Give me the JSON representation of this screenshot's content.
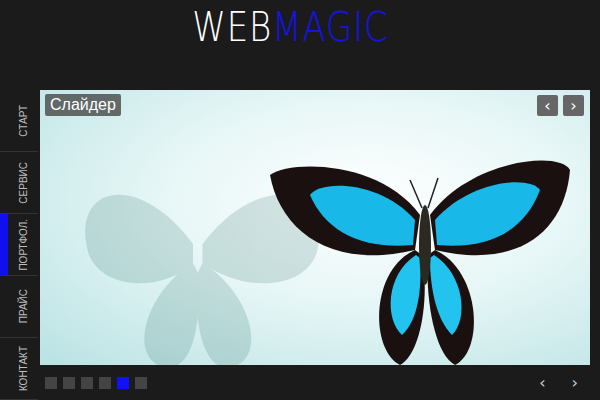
{
  "logo": {
    "part1": "WEB",
    "part2": "MAGIC"
  },
  "nav": [
    {
      "label": "СТАРТ",
      "selected": false
    },
    {
      "label": "СЕРВИС",
      "selected": false
    },
    {
      "label": "ПОРТФОЛ.",
      "selected": true
    },
    {
      "label": "ПРАЙС",
      "selected": false
    },
    {
      "label": "КОНТАКТ",
      "selected": false
    }
  ],
  "slider": {
    "title": "Слайдер",
    "prev": "‹",
    "next": "›",
    "dots": [
      {
        "selected": false
      },
      {
        "selected": false
      },
      {
        "selected": false
      },
      {
        "selected": false
      },
      {
        "selected": true
      },
      {
        "selected": false
      }
    ],
    "bottom_prev": "‹",
    "bottom_next": "›"
  }
}
